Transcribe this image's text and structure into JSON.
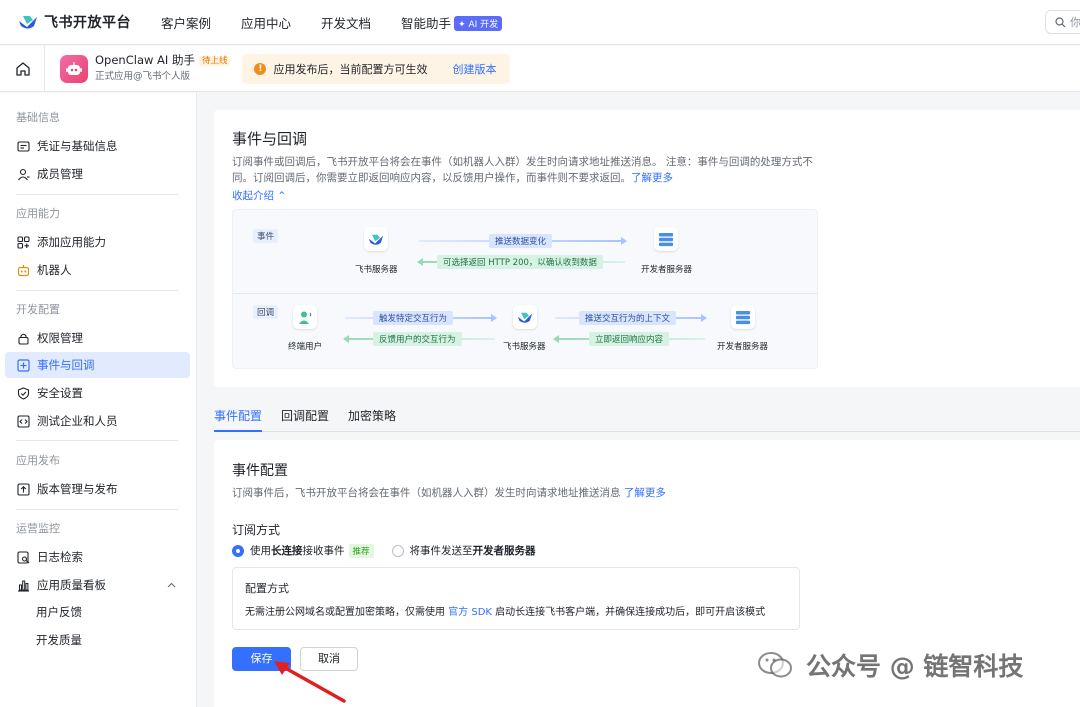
{
  "topnav": {
    "logo_text": "飞书开放平台",
    "items": [
      "客户案例",
      "应用中心",
      "开发文档",
      "智能助手"
    ],
    "ai_badge": "✦ AI 开发",
    "search_placeholder": "你"
  },
  "app": {
    "name": "OpenClaw AI 助手",
    "status_tag": "待上线",
    "subtitle": "正式应用@飞书个人版"
  },
  "notice": {
    "text": "应用发布后，当前配置方可生效",
    "link": "创建版本"
  },
  "sidebar": {
    "groups": [
      {
        "label": "基础信息",
        "items": [
          "凭证与基础信息",
          "成员管理"
        ]
      },
      {
        "label": "应用能力",
        "items": [
          "添加应用能力",
          "机器人"
        ]
      },
      {
        "label": "开发配置",
        "items": [
          "权限管理",
          "事件与回调",
          "安全设置",
          "测试企业和人员"
        ]
      },
      {
        "label": "应用发布",
        "items": [
          "版本管理与发布"
        ]
      },
      {
        "label": "运营监控",
        "items": [
          "日志检索",
          "应用质量看板"
        ]
      }
    ],
    "sub_items": [
      "用户反馈",
      "开发质量"
    ],
    "active_item": "事件与回调"
  },
  "intro": {
    "title": "事件与回调",
    "desc_line1": "订阅事件或回调后，飞书开放平台将会在事件（如机器人入群）发生时向请求地址推送消息。 注意：事件与回调的处理方式不",
    "desc_line2": "同。订阅回调后，你需要立即返回响应内容，以反馈用户操作，而事件则不要求返回。",
    "learn_more": "了解更多",
    "collapse": "收起介绍 ⌃"
  },
  "diagram": {
    "event_label": "事件",
    "callback_label": "回调",
    "feishu_server": "飞书服务器",
    "dev_server": "开发者服务器",
    "end_user": "终端用户",
    "push_data": "推送数据变化",
    "return_http": "可选择返回 HTTP 200，以确认收到数据",
    "trigger": "触发特定交互行为",
    "feedback": "反馈用户的交互行为",
    "push_context": "推送交互行为的上下文",
    "respond": "立即返回响应内容"
  },
  "tabs": [
    "事件配置",
    "回调配置",
    "加密策略"
  ],
  "event_config": {
    "title": "事件配置",
    "desc": "订阅事件后，飞书开放平台将会在事件（如机器人入群）发生时向请求地址推送消息",
    "learn_more": "了解更多",
    "subscribe_label": "订阅方式",
    "option1_pre": "使用 ",
    "option1_bold": "长连接",
    "option1_post": " 接收事件",
    "option1_tag": "推荐",
    "option2_pre": "将事件发送至 ",
    "option2_bold": "开发者服务器",
    "config_title": "配置方式",
    "config_text_pre": "无需注册公网域名或配置加密策略，仅需使用 ",
    "config_link": "官方 SDK",
    "config_text_post": " 启动长连接飞书客户端，并确保连接成功后，即可开启该模式",
    "save": "保存",
    "cancel": "取消"
  },
  "watermark": "公众号 @ 链智科技",
  "colors": {
    "primary": "#3370ff",
    "arrow": "#e02020"
  }
}
